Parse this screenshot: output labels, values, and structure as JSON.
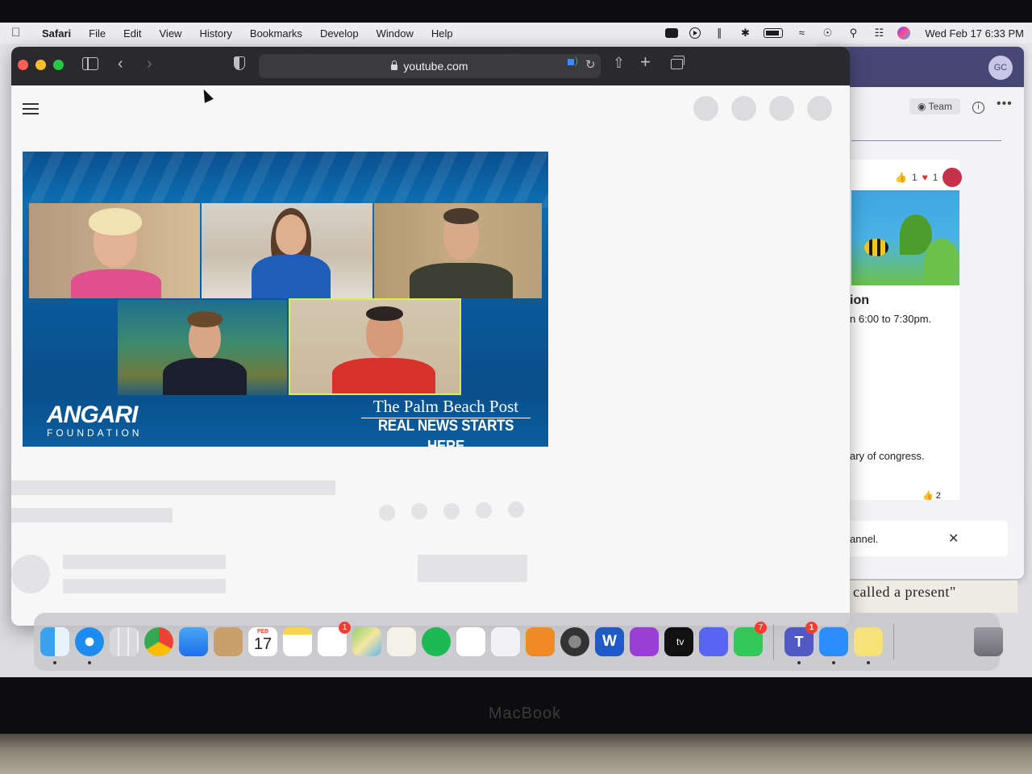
{
  "menubar": {
    "app_name": "Safari",
    "items": [
      "File",
      "Edit",
      "View",
      "History",
      "Bookmarks",
      "Develop",
      "Window",
      "Help"
    ],
    "clock": "Wed Feb 17  6:33 PM"
  },
  "safari": {
    "url": "youtube.com"
  },
  "video": {
    "sponsor_main": "ANGARI",
    "sponsor_sub": "FOUNDATION",
    "paper_title": "The Palm Beach Post",
    "paper_tagline": "REAL NEWS STARTS HERE"
  },
  "teams": {
    "avatar_initials": "GC",
    "team_label": "Team",
    "reaction_like_count": "1",
    "reaction_heart_count": "1",
    "card_title_fragment": "ion",
    "card_time_fragment": "n 6:00 to 7:30pm.",
    "card_body_fragment": "ary of congress.",
    "card_like_count": "2",
    "banner_text_fragment": "annel."
  },
  "book_text": "called a present\"",
  "dock": {
    "calendar_month": "FEB",
    "calendar_day": "17",
    "reminders_badge": "1",
    "messages_badge": "7",
    "teams_badge": "1",
    "word_letter": "W",
    "tv_label": " tv",
    "teams_letter": "T"
  },
  "bezel_label": "MacBook",
  "colors": {
    "toolbar": "#2a2a2e",
    "teams_header": "#464775",
    "video_blue": "#0c6fb2",
    "badge_red": "#ff3b30",
    "speaker_blue": "#3d8bff"
  }
}
